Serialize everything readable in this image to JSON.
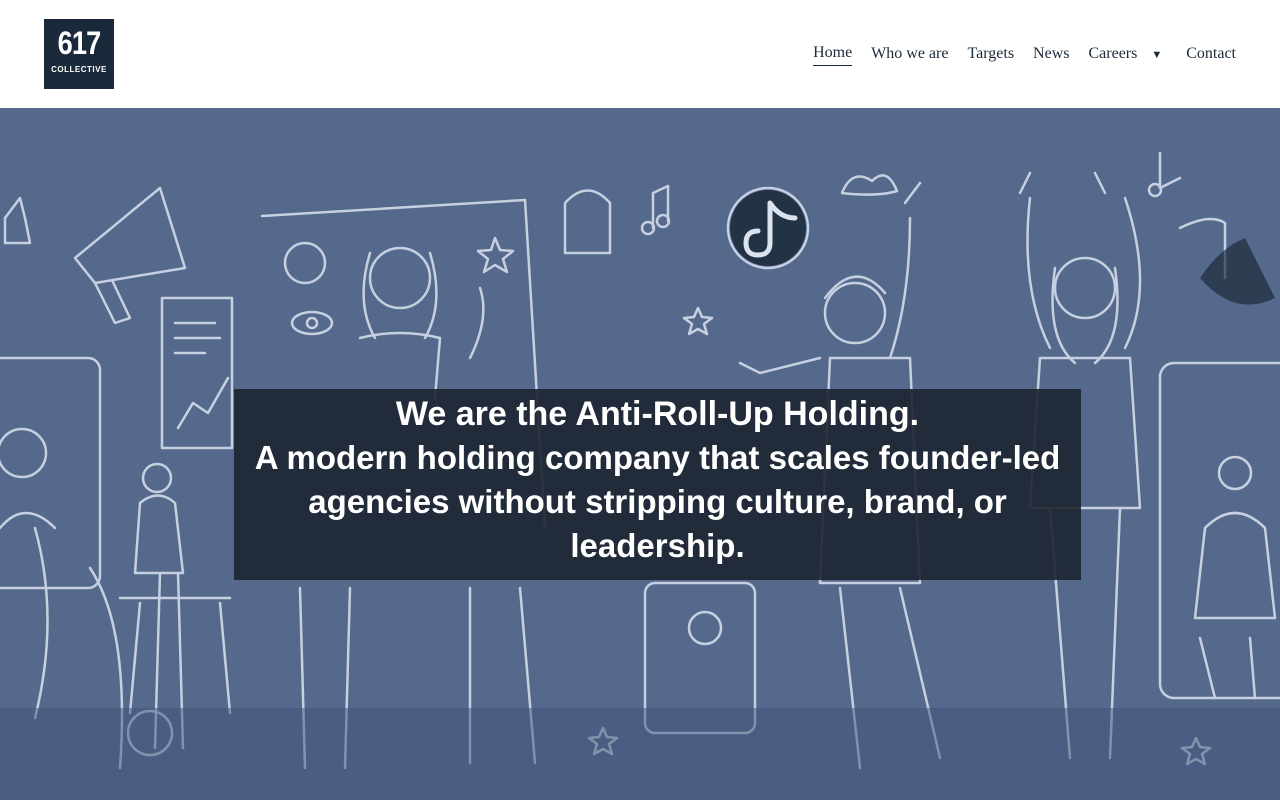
{
  "brand": {
    "logo_number": "617",
    "logo_subtitle": "COLLECTIVE"
  },
  "nav": {
    "items": [
      {
        "label": "Home",
        "active": true
      },
      {
        "label": "Who we are"
      },
      {
        "label": "Targets"
      },
      {
        "label": "News"
      },
      {
        "label": "Careers",
        "has_dropdown": true
      },
      {
        "label": "Contact"
      }
    ]
  },
  "hero": {
    "headline": "We are the Anti-Roll-Up Holding.",
    "subheadline": "A modern holding company that scales founder-led agencies without stripping culture, brand, or leadership.",
    "background_color": "#55698c",
    "overlay_color": "#1e2632"
  },
  "colors": {
    "accent": "#1b2a3a"
  }
}
